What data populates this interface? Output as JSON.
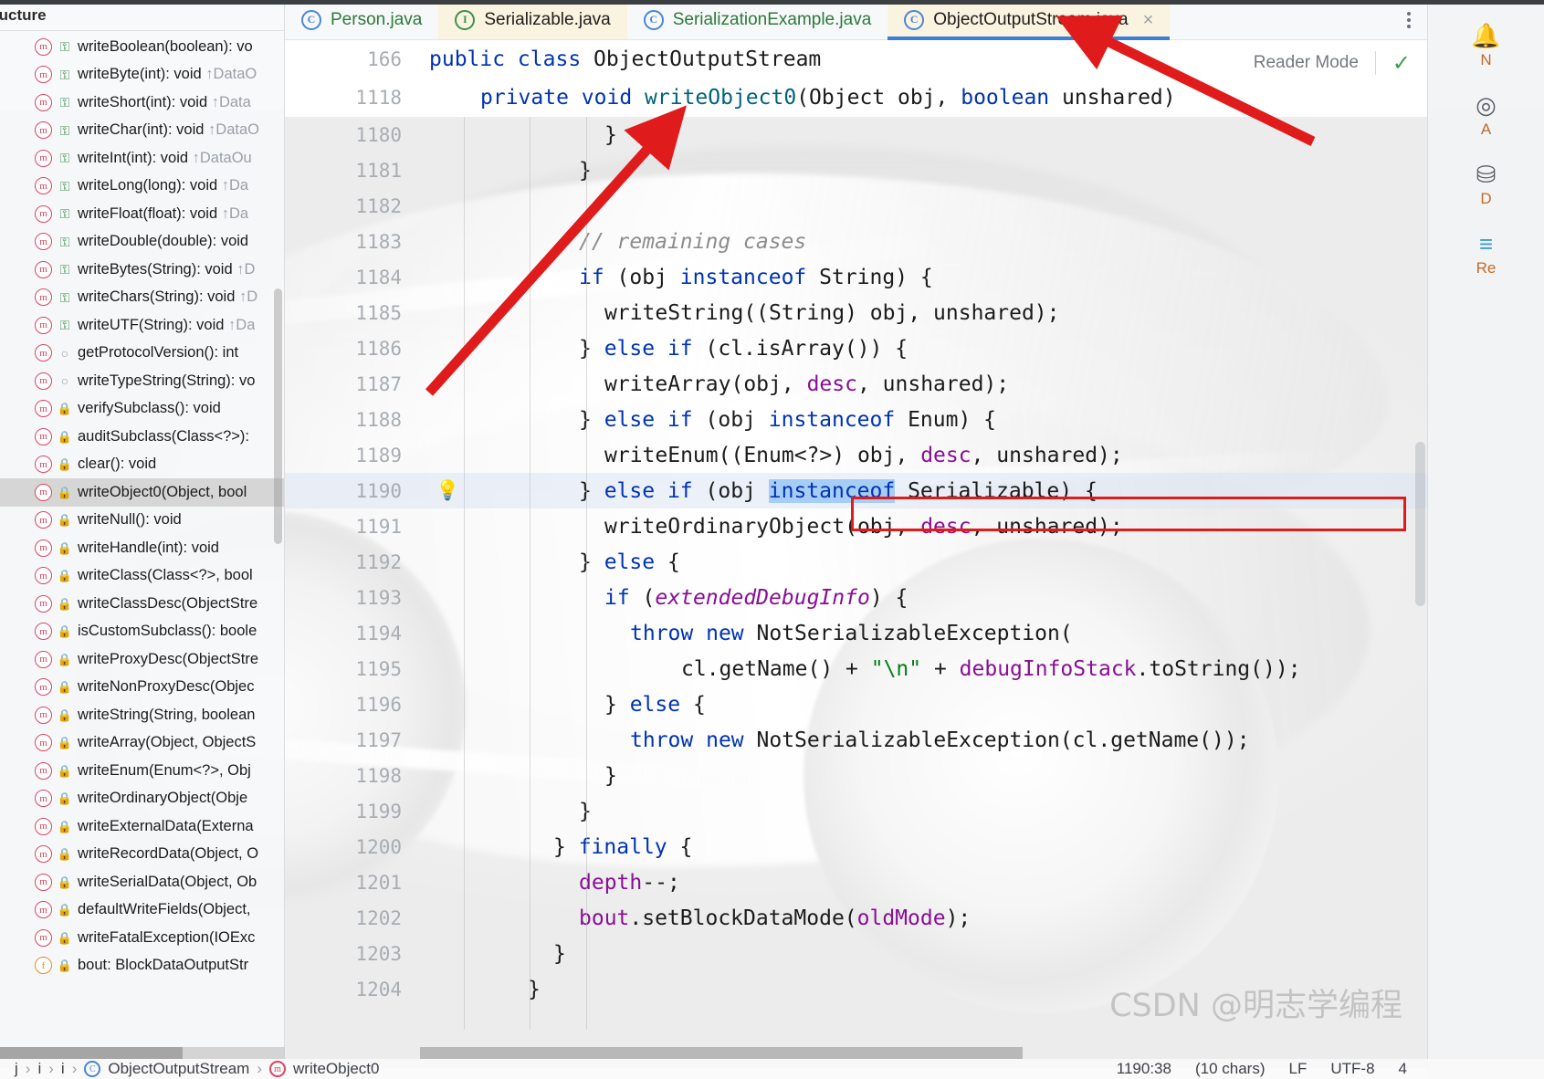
{
  "window": {
    "structure_panel_title": "ructure",
    "watermark": "CSDN @明志学编程"
  },
  "tabs": [
    {
      "label": "Person.java",
      "icon": "class-icon",
      "glyph": "C",
      "active": false,
      "closable": false
    },
    {
      "label": "Serializable.java",
      "icon": "interface-icon",
      "glyph": "I",
      "active": false,
      "closable": false
    },
    {
      "label": "SerializationExample.java",
      "icon": "runnable-class-icon",
      "glyph": "C",
      "active": false,
      "closable": false
    },
    {
      "label": "ObjectOutputStream.java",
      "icon": "class-icon",
      "glyph": "C",
      "active": true,
      "closable": true,
      "close_label": "×"
    }
  ],
  "editor": {
    "reader_mode_label": "Reader Mode",
    "reader_mode_check": "✓",
    "sticky_lines": [
      {
        "number": "166",
        "indent": 0,
        "text": "public class ObjectOutputStream"
      },
      {
        "number": "1118",
        "indent": 1,
        "text": "private void writeObject0(Object obj, boolean unshared)"
      }
    ],
    "lines": [
      {
        "number": "1180",
        "text": "}",
        "indent": 5,
        "bulb": false,
        "highlight": false
      },
      {
        "number": "1181",
        "text": "}",
        "indent": 4,
        "bulb": false,
        "highlight": false
      },
      {
        "number": "1182",
        "text": "",
        "indent": 0,
        "bulb": false,
        "highlight": false
      },
      {
        "number": "1183",
        "text": "// remaining cases",
        "indent": 4,
        "bulb": false,
        "highlight": false
      },
      {
        "number": "1184",
        "text": "if (obj instanceof String) {",
        "indent": 4,
        "bulb": false,
        "highlight": false
      },
      {
        "number": "1185",
        "text": "writeString((String) obj, unshared);",
        "indent": 5,
        "bulb": false,
        "highlight": false
      },
      {
        "number": "1186",
        "text": "} else if (cl.isArray()) {",
        "indent": 4,
        "bulb": false,
        "highlight": false
      },
      {
        "number": "1187",
        "text": "writeArray(obj, desc, unshared);",
        "indent": 5,
        "bulb": false,
        "highlight": false
      },
      {
        "number": "1188",
        "text": "} else if (obj instanceof Enum) {",
        "indent": 4,
        "bulb": false,
        "highlight": false
      },
      {
        "number": "1189",
        "text": "writeEnum((Enum<?>) obj, desc, unshared);",
        "indent": 5,
        "bulb": false,
        "highlight": false
      },
      {
        "number": "1190",
        "text": "} else if (obj instanceof Serializable) {",
        "indent": 4,
        "bulb": true,
        "highlight": true
      },
      {
        "number": "1191",
        "text": "writeOrdinaryObject(obj, desc, unshared);",
        "indent": 5,
        "bulb": false,
        "highlight": false
      },
      {
        "number": "1192",
        "text": "} else {",
        "indent": 4,
        "bulb": false,
        "highlight": false
      },
      {
        "number": "1193",
        "text": "if (extendedDebugInfo) {",
        "indent": 5,
        "bulb": false,
        "highlight": false
      },
      {
        "number": "1194",
        "text": "throw new NotSerializableException(",
        "indent": 6,
        "bulb": false,
        "highlight": false
      },
      {
        "number": "1195",
        "text": "cl.getName() + \"\\n\" + debugInfoStack.toString());",
        "indent": 8,
        "bulb": false,
        "highlight": false
      },
      {
        "number": "1196",
        "text": "} else {",
        "indent": 5,
        "bulb": false,
        "highlight": false
      },
      {
        "number": "1197",
        "text": "throw new NotSerializableException(cl.getName());",
        "indent": 6,
        "bulb": false,
        "highlight": false
      },
      {
        "number": "1198",
        "text": "}",
        "indent": 5,
        "bulb": false,
        "highlight": false
      },
      {
        "number": "1199",
        "text": "}",
        "indent": 4,
        "bulb": false,
        "highlight": false
      },
      {
        "number": "1200",
        "text": "} finally {",
        "indent": 3,
        "bulb": false,
        "highlight": false
      },
      {
        "number": "1201",
        "text": "depth--;",
        "indent": 4,
        "bulb": false,
        "highlight": false
      },
      {
        "number": "1202",
        "text": "bout.setBlockDataMode(oldMode);",
        "indent": 4,
        "bulb": false,
        "highlight": false
      },
      {
        "number": "1203",
        "text": "}",
        "indent": 3,
        "bulb": false,
        "highlight": false
      },
      {
        "number": "1204",
        "text": "}",
        "indent": 2,
        "bulb": false,
        "highlight": false
      }
    ],
    "bulb_glyph": "💡",
    "selected_token": "instanceof"
  },
  "structure": {
    "title": "ructure",
    "items": [
      {
        "name": "writeBoolean(boolean): vo",
        "visibility": "public",
        "kind": "method",
        "inherit": "",
        "selected": false
      },
      {
        "name": "writeByte(int): void ",
        "visibility": "public",
        "kind": "method",
        "inherit": "↑DataO",
        "selected": false
      },
      {
        "name": "writeShort(int): void ",
        "visibility": "public",
        "kind": "method",
        "inherit": "↑Data",
        "selected": false
      },
      {
        "name": "writeChar(int): void ",
        "visibility": "public",
        "kind": "method",
        "inherit": "↑DataO",
        "selected": false
      },
      {
        "name": "writeInt(int): void ",
        "visibility": "public",
        "kind": "method",
        "inherit": "↑DataOu",
        "selected": false
      },
      {
        "name": "writeLong(long): void ",
        "visibility": "public",
        "kind": "method",
        "inherit": "↑Da",
        "selected": false
      },
      {
        "name": "writeFloat(float): void ",
        "visibility": "public",
        "kind": "method",
        "inherit": "↑Da",
        "selected": false
      },
      {
        "name": "writeDouble(double): void",
        "visibility": "public",
        "kind": "method",
        "inherit": "",
        "selected": false
      },
      {
        "name": "writeBytes(String): void ",
        "visibility": "public",
        "kind": "method",
        "inherit": "↑D",
        "selected": false
      },
      {
        "name": "writeChars(String): void ",
        "visibility": "public",
        "kind": "method",
        "inherit": "↑D",
        "selected": false
      },
      {
        "name": "writeUTF(String): void ",
        "visibility": "public",
        "kind": "method",
        "inherit": "↑Da",
        "selected": false
      },
      {
        "name": "getProtocolVersion(): int",
        "visibility": "package",
        "kind": "method",
        "inherit": "",
        "selected": false
      },
      {
        "name": "writeTypeString(String): vo",
        "visibility": "package",
        "kind": "method",
        "inherit": "",
        "selected": false
      },
      {
        "name": "verifySubclass(): void",
        "visibility": "private",
        "kind": "method",
        "inherit": "",
        "selected": false
      },
      {
        "name": "auditSubclass(Class<?>): ",
        "visibility": "private",
        "kind": "method",
        "inherit": "",
        "selected": false
      },
      {
        "name": "clear(): void",
        "visibility": "private",
        "kind": "method",
        "inherit": "",
        "selected": false
      },
      {
        "name": "writeObject0(Object, bool",
        "visibility": "private",
        "kind": "method",
        "inherit": "",
        "selected": true
      },
      {
        "name": "writeNull(): void",
        "visibility": "private",
        "kind": "method",
        "inherit": "",
        "selected": false
      },
      {
        "name": "writeHandle(int): void",
        "visibility": "private",
        "kind": "method",
        "inherit": "",
        "selected": false
      },
      {
        "name": "writeClass(Class<?>, bool",
        "visibility": "private",
        "kind": "method",
        "inherit": "",
        "selected": false
      },
      {
        "name": "writeClassDesc(ObjectStre",
        "visibility": "private",
        "kind": "method",
        "inherit": "",
        "selected": false
      },
      {
        "name": "isCustomSubclass(): boole",
        "visibility": "private",
        "kind": "method",
        "inherit": "",
        "selected": false
      },
      {
        "name": "writeProxyDesc(ObjectStre",
        "visibility": "private",
        "kind": "method",
        "inherit": "",
        "selected": false
      },
      {
        "name": "writeNonProxyDesc(Objec",
        "visibility": "private",
        "kind": "method",
        "inherit": "",
        "selected": false
      },
      {
        "name": "writeString(String, boolean",
        "visibility": "private",
        "kind": "method",
        "inherit": "",
        "selected": false
      },
      {
        "name": "writeArray(Object, ObjectS",
        "visibility": "private",
        "kind": "method",
        "inherit": "",
        "selected": false
      },
      {
        "name": "writeEnum(Enum<?>, Obj",
        "visibility": "private",
        "kind": "method",
        "inherit": "",
        "selected": false
      },
      {
        "name": "writeOrdinaryObject(Obje",
        "visibility": "private",
        "kind": "method",
        "inherit": "",
        "selected": false
      },
      {
        "name": "writeExternalData(Externa",
        "visibility": "private",
        "kind": "method",
        "inherit": "",
        "selected": false
      },
      {
        "name": "writeRecordData(Object, O",
        "visibility": "private",
        "kind": "method",
        "inherit": "",
        "selected": false
      },
      {
        "name": "writeSerialData(Object, Ob",
        "visibility": "private",
        "kind": "method",
        "inherit": "",
        "selected": false
      },
      {
        "name": "defaultWriteFields(Object,",
        "visibility": "private",
        "kind": "method",
        "inherit": "",
        "selected": false
      },
      {
        "name": "writeFatalException(IOExc",
        "visibility": "private",
        "kind": "method",
        "inherit": "",
        "selected": false
      },
      {
        "name": "bout: BlockDataOutputStr",
        "visibility": "private",
        "kind": "field",
        "inherit": "",
        "selected": false
      }
    ]
  },
  "right_strip": [
    {
      "label": "N",
      "icon": "notifications-icon",
      "glyph": "🔔"
    },
    {
      "label": "A",
      "icon": "target-icon",
      "glyph": "◎"
    },
    {
      "label": "D",
      "icon": "database-icon",
      "glyph": "⛁"
    },
    {
      "label": "Re",
      "icon": "layers-icon",
      "glyph": "≡"
    }
  ],
  "breadcrumb": {
    "items": [
      "j",
      "i",
      "i"
    ],
    "class": "ObjectOutputStream",
    "method": "writeObject0",
    "separator": "›"
  },
  "status_bar": {
    "caret": "1190:38",
    "chars": "(10 chars)",
    "line_sep": "LF",
    "encoding": "UTF-8",
    "indent": "4"
  },
  "colors": {
    "accent": "#3b7ddd",
    "active_tab_bg": "#faf3e0",
    "annotation_red": "#e01b1b",
    "keyword": "#0033b3",
    "string": "#067d17",
    "comment": "#8c8c8c",
    "field": "#871094",
    "selection": "#a6cdf5"
  }
}
